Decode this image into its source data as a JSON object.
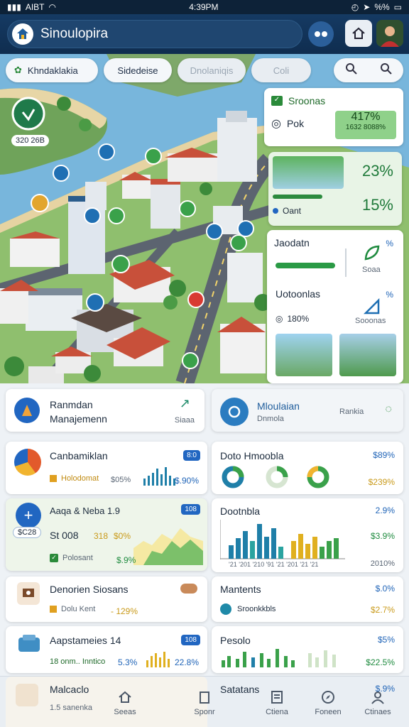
{
  "status": {
    "carrier": "AIBT",
    "time": "4:39PM",
    "battery": "%%"
  },
  "header": {
    "app_title": "Sinoulopira"
  },
  "map": {
    "filters": [
      "Khndaklakia",
      "Sidedeise",
      "Dnolaniqis",
      "Coli"
    ],
    "badge_label": "320 26B"
  },
  "stats": {
    "card1": {
      "title": "Sroonas",
      "row_label": "Pok",
      "value_big": "417%",
      "value_small": "1632 8088%"
    },
    "card2": {
      "label": "Oant",
      "value1": "23%",
      "value2": "15%"
    },
    "card3": {
      "item1": {
        "title": "Jaodatn",
        "pct": "%",
        "sub": "Soaa"
      },
      "item2": {
        "title": "Uotoonlas",
        "pct": "%",
        "value": "180%",
        "sub": "Sooonas"
      }
    }
  },
  "cards": {
    "management": {
      "line1": "Ranmdan",
      "line2": "Manajemenn",
      "sub": "Siaaa"
    },
    "monitor": {
      "line1": "Mloulaian",
      "line2": "Dnmola",
      "action": "Rankia"
    },
    "c1": {
      "title": "Canbamiklan",
      "row": "Holodomat",
      "v1": "$05%",
      "v2": "$.90%",
      "badge": "8:0"
    },
    "c2": {
      "title": "Doto Hmoobla",
      "pct1": "$89%",
      "pct2": "$239%"
    },
    "c3": {
      "title": "Aaqa & Neba 1.9",
      "badge": "108",
      "label": "$C28",
      "line": "St 008",
      "v1": "318",
      "v2": "$0%",
      "row": "Polosant",
      "v3": "$.9%"
    },
    "c4": {
      "title": "Dootnbla",
      "pct1": "2.9%",
      "pct2": "$3.9%",
      "pct3": "2010%",
      "axis": "'21 '201 '210 '91 '21 '201 '21 '21"
    },
    "c5": {
      "title": "Denorien Siosans",
      "row": "Dolu Kent",
      "v": "- 129%"
    },
    "c6": {
      "title": "Mantents",
      "pct1": "$.0%",
      "row": "Sroonkkbls",
      "pct2": "$2.7%"
    },
    "c7": {
      "title": "Aapstameies 14",
      "badge": "108",
      "row": "18 onm.. Inntico",
      "v1": "5.3%",
      "v2": "22.8%"
    },
    "c8": {
      "title": "Pesolo",
      "pct1": "$5%",
      "pct2": "$22.5%"
    },
    "c9": {
      "title": "Malcaclo",
      "row": "1.5 sanenka"
    },
    "c10": {
      "title": "Satatans",
      "pct": "$.9%"
    }
  },
  "nav": {
    "items": [
      "Seeas",
      "Sponr",
      "Ctiena",
      "Foneen",
      "Ctinaes"
    ]
  },
  "colors": {
    "accent": "#2166c1",
    "green": "#1f8b3f",
    "yellow": "#e0b020"
  }
}
